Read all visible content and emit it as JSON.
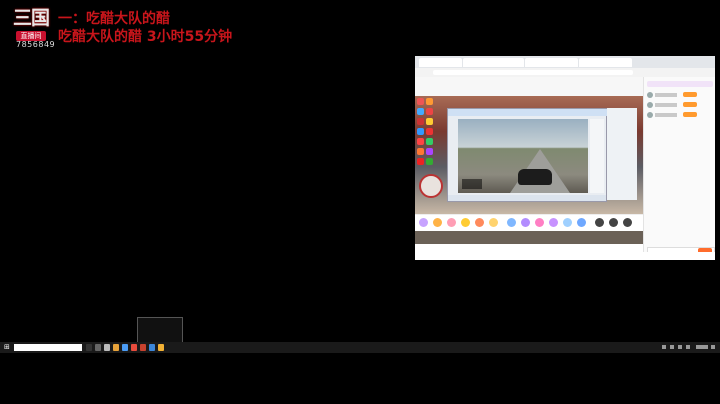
{
  "stream_overlay": {
    "logo_mark": "三国",
    "logo_tag": "直播间",
    "room_id": "7856849",
    "line1": "一：吃醋大队的醋",
    "line2": "吃醋大队的醋 3小时55分钟"
  },
  "embedded_screenshot": {
    "address_text": "",
    "stream_title": "",
    "taskbar_search_placeholder": ""
  },
  "popup": {
    "title": ""
  },
  "taskbar": {
    "search_placeholder": ""
  },
  "colors": {
    "overlay_text": "#c8151b",
    "background": "#000000",
    "accent_orange": "#ff6c2c"
  }
}
